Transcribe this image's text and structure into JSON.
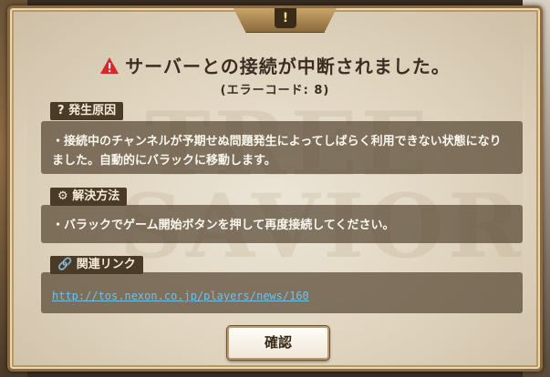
{
  "dialog": {
    "ornament_mark": "!",
    "title": "サーバーとの接続が中断されました。",
    "error_code": "(エラーコード: 8)",
    "cause": {
      "heading": "発生原因",
      "body": "・接続中のチャンネルが予期せぬ問題発生によってしばらく利用できない状態になりました。自動的にバラックに移動します。"
    },
    "solution": {
      "heading": "解決方法",
      "body": "・バラックでゲーム開始ボタンを押して再度接続してください。"
    },
    "related": {
      "heading": "関連リンク",
      "url": "http://tos.nexon.co.jp/players/news/160"
    },
    "confirm_label": "確認",
    "watermark": "TREE SAVIOR"
  },
  "colors": {
    "warning": "#d8262b",
    "section_bg": "#584834",
    "link": "#6fc0ea"
  },
  "icons": {
    "title": "warning-triangle-icon",
    "cause": "question-icon",
    "solution": "gear-icon",
    "related": "link-icon"
  }
}
